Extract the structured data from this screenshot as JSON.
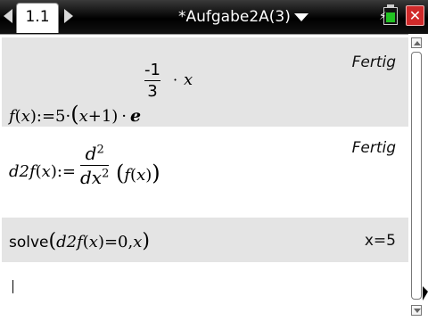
{
  "titlebar": {
    "tab_label": "1.1",
    "doc_title": "*Aufgabe2A(3)",
    "battery_level": 0.7,
    "close_glyph": "✕",
    "charging_glyph": "⚡"
  },
  "calc": {
    "entries": [
      {
        "f_name": "f",
        "x_var": "x",
        "assign": "):=5·",
        "lparen": "(",
        "plus1": "+1)",
        "dot": "·",
        "e": "e",
        "exp_num": "-1",
        "exp_den": "3",
        "exp_dot": "·",
        "exp_x": "x",
        "result": "Fertig"
      },
      {
        "name": "d2f",
        "x_var": "x",
        "assign": "):=",
        "d2_num": "d",
        "d2_num_sup": "2",
        "d2_den": "dx",
        "d2_den_sup": "2",
        "f_name": "f",
        "result": "Fertig"
      },
      {
        "cmd": "solve",
        "arg_func": "d2f",
        "arg_x": "x",
        "arg_rest": ")=0,",
        "arg_var": "x",
        "result": "x=5"
      }
    ]
  },
  "colors": {
    "shade": "#e4e4e4",
    "titlebar": "#000000",
    "close": "#d02a2a",
    "battery": "#22c322"
  }
}
